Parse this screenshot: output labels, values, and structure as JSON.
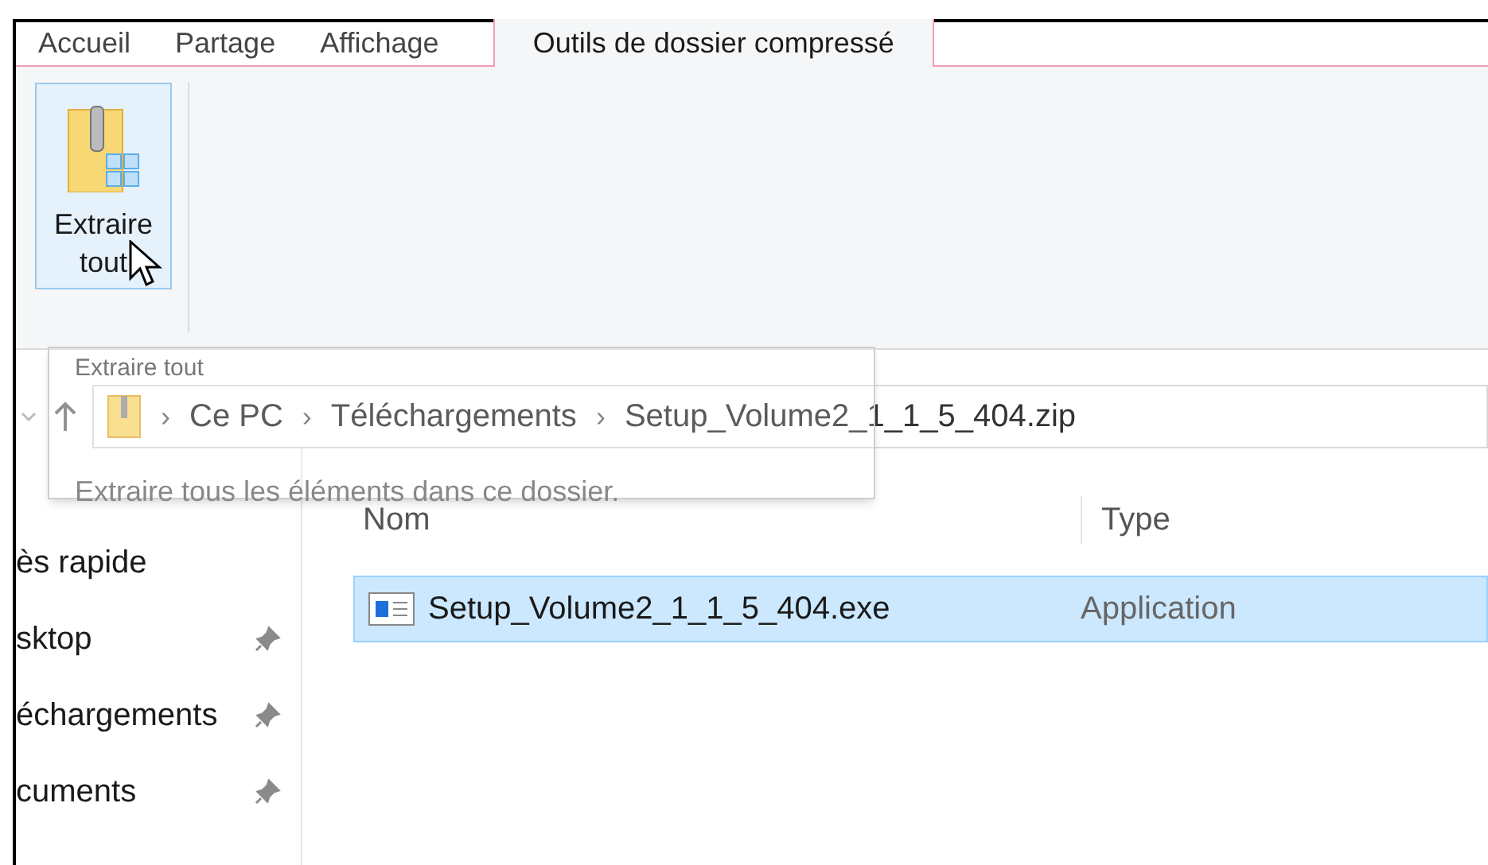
{
  "ribbon_tabs": [
    {
      "label": "Accueil",
      "selected": false
    },
    {
      "label": "Partage",
      "selected": false
    },
    {
      "label": "Affichage",
      "selected": false
    },
    {
      "label": "Outils de dossier compressé",
      "selected": true
    }
  ],
  "ribbon": {
    "extract_button": {
      "label_line_1": "Extraire",
      "label_line_2": "tout"
    }
  },
  "tooltip": {
    "title": "Extraire tout",
    "description": "Extraire tous les éléments dans ce dossier."
  },
  "breadcrumb": [
    {
      "separator": "›",
      "label": "Ce PC"
    },
    {
      "separator": "›",
      "label": "Téléchargements"
    },
    {
      "separator": "›",
      "label": "Setup_Volume2_1_1_5_404.zip"
    }
  ],
  "sidebar": {
    "items": [
      {
        "label": "ès rapide",
        "pinned": false
      },
      {
        "label": "sktop",
        "pinned": true
      },
      {
        "label": "échargements",
        "pinned": true
      },
      {
        "label": "cuments",
        "pinned": true
      }
    ]
  },
  "table": {
    "columns": [
      "Nom",
      "Type"
    ],
    "rows": [
      {
        "name": "Setup_Volume2_1_1_5_404.exe",
        "type": "Application",
        "selected": true
      }
    ]
  }
}
